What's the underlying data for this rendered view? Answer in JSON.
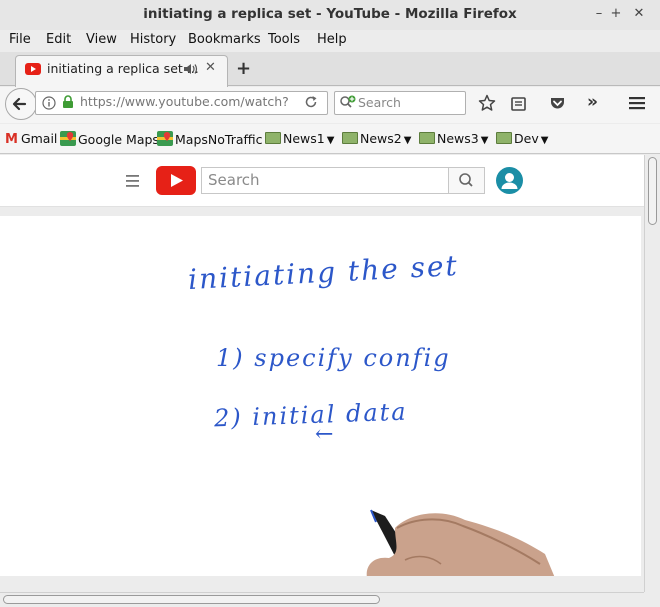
{
  "window": {
    "title": "initiating a replica set - YouTube - Mozilla Firefox"
  },
  "menu": [
    "File",
    "Edit",
    "View",
    "History",
    "Bookmarks",
    "Tools",
    "Help"
  ],
  "tab": {
    "title": "initiating a replica set ...",
    "new_tab": "+"
  },
  "navbar": {
    "url": "https://www.youtube.com/watch?",
    "search_placeholder": "Search"
  },
  "bookmarks": [
    "Gmail",
    "Google Maps",
    "MapsNoTraffic",
    "News1",
    "News2",
    "News3",
    "Dev"
  ],
  "youtube": {
    "search_placeholder": "Search"
  },
  "video": {
    "line1": "initiating the set",
    "line2": "1) specify config",
    "line3": "2) initial data",
    "line4": "←"
  },
  "colors": {
    "youtube_red": "#e62117",
    "hand_ink": "#2c57c9"
  }
}
